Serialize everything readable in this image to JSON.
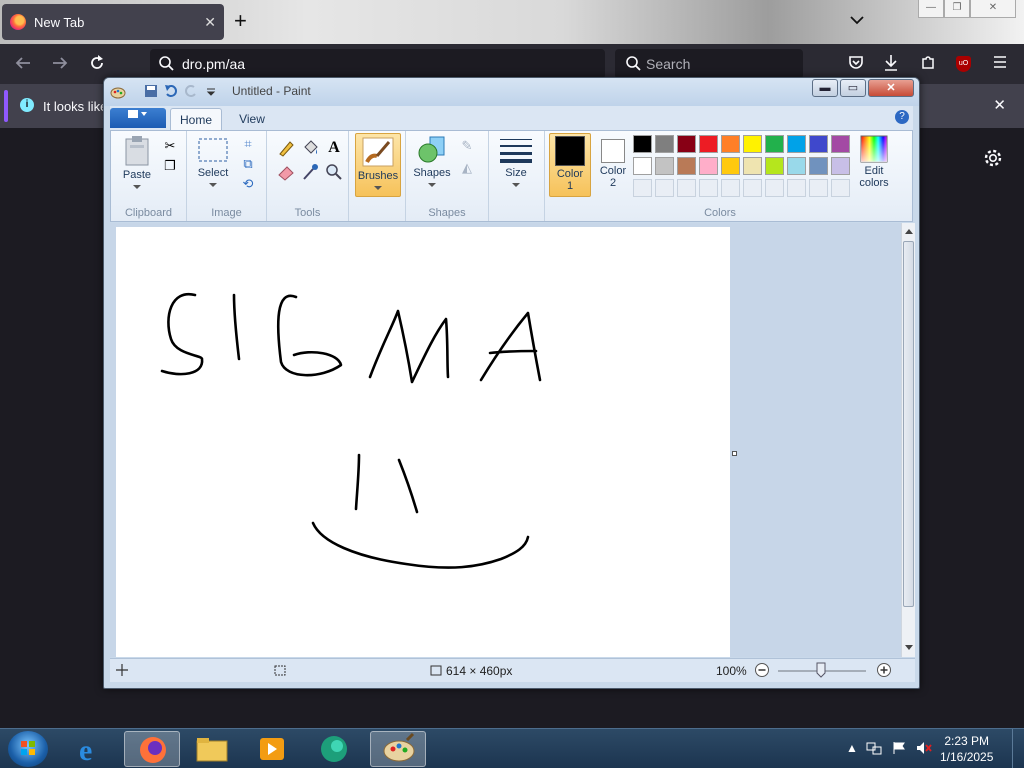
{
  "browser": {
    "tab_title": "New Tab",
    "tab_close": "✕",
    "new_tab": "+",
    "list_all_tabs": "⌄",
    "url": "dro.pm/aa",
    "search_placeholder": "Search",
    "notification_text": "It looks like",
    "notification_close": "✕",
    "ublock_label": "uO",
    "win_minimize": "—",
    "win_restore": "❐",
    "win_close": "✕"
  },
  "paint": {
    "window_title": "Untitled - Paint",
    "tabs": {
      "home": "Home",
      "view": "View"
    },
    "help": "?",
    "ribbon": {
      "clipboard": {
        "paste": "Paste",
        "group": "Clipboard"
      },
      "image": {
        "select": "Select",
        "group": "Image"
      },
      "tools": {
        "group": "Tools"
      },
      "brushes": {
        "label": "Brushes"
      },
      "shapes": {
        "label": "Shapes",
        "group": "Shapes"
      },
      "size": {
        "label": "Size"
      },
      "color1": {
        "line1": "Color",
        "line2": "1"
      },
      "color2": {
        "line1": "Color",
        "line2": "2"
      },
      "edit_colors": {
        "line1": "Edit",
        "line2": "colors"
      },
      "colors_group": "Colors"
    },
    "palette": {
      "row1": [
        "#000000",
        "#7f7f7f",
        "#880015",
        "#ed1c24",
        "#ff7f27",
        "#fff200",
        "#22b14c",
        "#00a2e8",
        "#3f48cc",
        "#a349a4"
      ],
      "row2": [
        "#ffffff",
        "#c3c3c3",
        "#b97a57",
        "#ffaec9",
        "#ffc90e",
        "#efe4b0",
        "#b5e61d",
        "#99d9ea",
        "#7092be",
        "#c8bfe7"
      ]
    },
    "color1_value": "#000000",
    "color2_value": "#ffffff",
    "canvas_text": "SIGMA",
    "status": {
      "canvas_size": "614 × 460px",
      "zoom": "100%"
    },
    "accent_selected": "#f8c460"
  },
  "taskbar": {
    "clock_time": "2:23 PM",
    "clock_date": "1/16/2025"
  }
}
